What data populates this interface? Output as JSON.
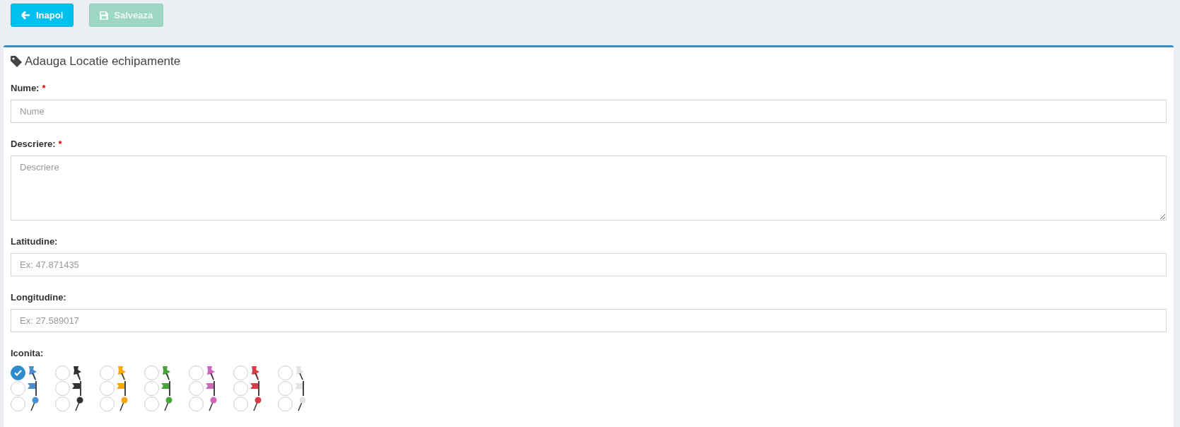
{
  "toolbar": {
    "buttons": [
      {
        "label": "Inapoi",
        "kind": "back",
        "disabled": false
      },
      {
        "label": "Salveaza",
        "kind": "save",
        "disabled": true
      }
    ]
  },
  "card": {
    "title": "Adauga Locatie echipamente",
    "fields": [
      {
        "label": "Nume:",
        "mark": "*",
        "kind": "input",
        "placeholder": "Nume"
      },
      {
        "label": "Descriere:",
        "mark": "*",
        "kind": "textarea",
        "placeholder": "Descriere"
      },
      {
        "label": "Latitudine:",
        "kind": "input",
        "placeholder": "Ex: 47.871435"
      },
      {
        "label": "Longitudine:",
        "kind": "input",
        "placeholder": "Ex: 27.589017"
      }
    ],
    "icon_picker": {
      "label": "Iconita:",
      "rows": [
        {
          "kind": "pushpin",
          "options": [
            {
              "color": "#4a8fd0",
              "selected": true
            },
            {
              "color": "#333333",
              "selected": false
            },
            {
              "color": "#f5a70a",
              "selected": false
            },
            {
              "color": "#4aa33d",
              "selected": false
            },
            {
              "color": "#cc66bb",
              "selected": false
            },
            {
              "color": "#d83c47",
              "selected": false
            },
            {
              "color": "#e2e2e2",
              "selected": false
            }
          ]
        },
        {
          "kind": "flag",
          "options": [
            {
              "color": "#4a8fd0",
              "selected": false
            },
            {
              "color": "#333333",
              "selected": false
            },
            {
              "color": "#f5a70a",
              "selected": false
            },
            {
              "color": "#4aa33d",
              "selected": false
            },
            {
              "color": "#cc66bb",
              "selected": false
            },
            {
              "color": "#d83c47",
              "selected": false
            },
            {
              "color": "#e2e2e2",
              "selected": false
            }
          ]
        },
        {
          "kind": "pin",
          "options": [
            {
              "color": "#4a8fd0",
              "selected": false
            },
            {
              "color": "#333333",
              "selected": false
            },
            {
              "color": "#f5a70a",
              "selected": false
            },
            {
              "color": "#4aa33d",
              "selected": false
            },
            {
              "color": "#cc66bb",
              "selected": false
            },
            {
              "color": "#d83c47",
              "selected": false
            },
            {
              "color": "#e2e2e2",
              "selected": false
            }
          ]
        }
      ]
    }
  }
}
